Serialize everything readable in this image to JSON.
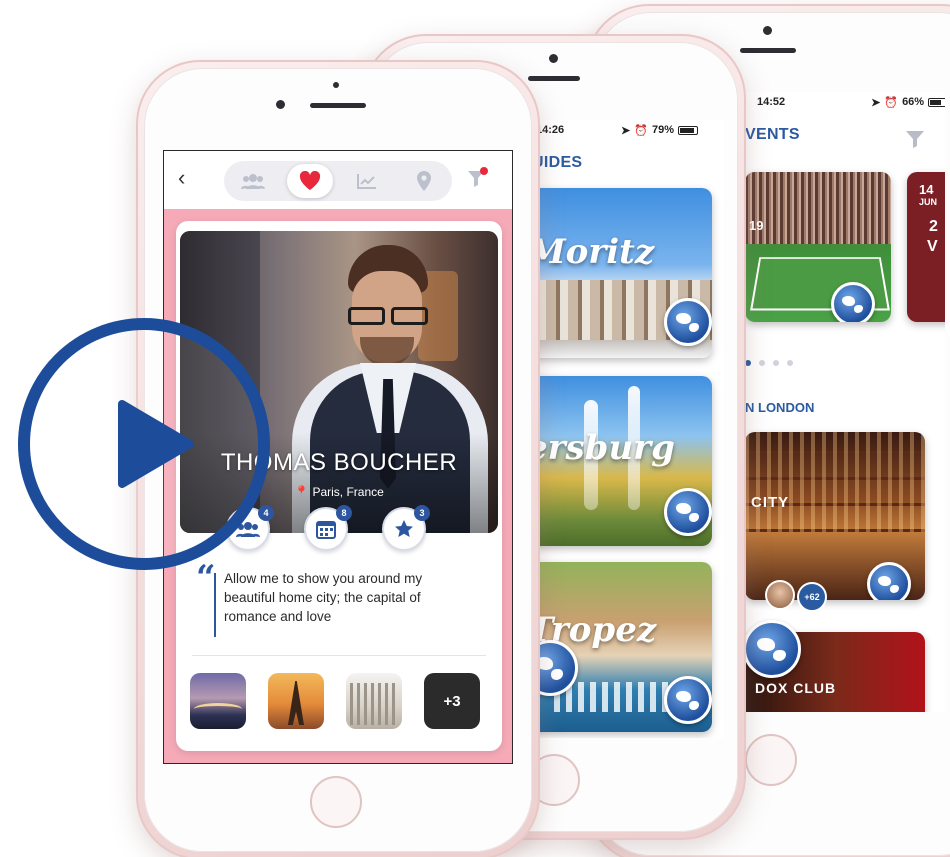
{
  "events_screen": {
    "time": "14:52",
    "battery": "66%",
    "title": "VENTS",
    "date_day": "14",
    "date_month": "JUN",
    "date_small": "19",
    "side_char_1": "2",
    "side_char_2": "V",
    "section": "N LONDON",
    "card2_label": "CITY",
    "more_count": "+62",
    "card3_label": "DOX CLUB"
  },
  "guides_screen": {
    "time": "14:26",
    "battery": "79%",
    "title": "UIDES",
    "guides": [
      "Moritz",
      "ersburg",
      "Tropez"
    ]
  },
  "profile_screen": {
    "name": "THOMAS BOUCHER",
    "location": "Paris, France",
    "badges": {
      "friends": "4",
      "calendar": "8",
      "favorites": "3"
    },
    "quote": "Allow me to show you around my beautiful home city; the capital of romance and love",
    "more_photos": "+3"
  },
  "colors": {
    "accent": "#2a5aa0",
    "heart": "#e8283c",
    "pink": "#f4a7b4"
  }
}
